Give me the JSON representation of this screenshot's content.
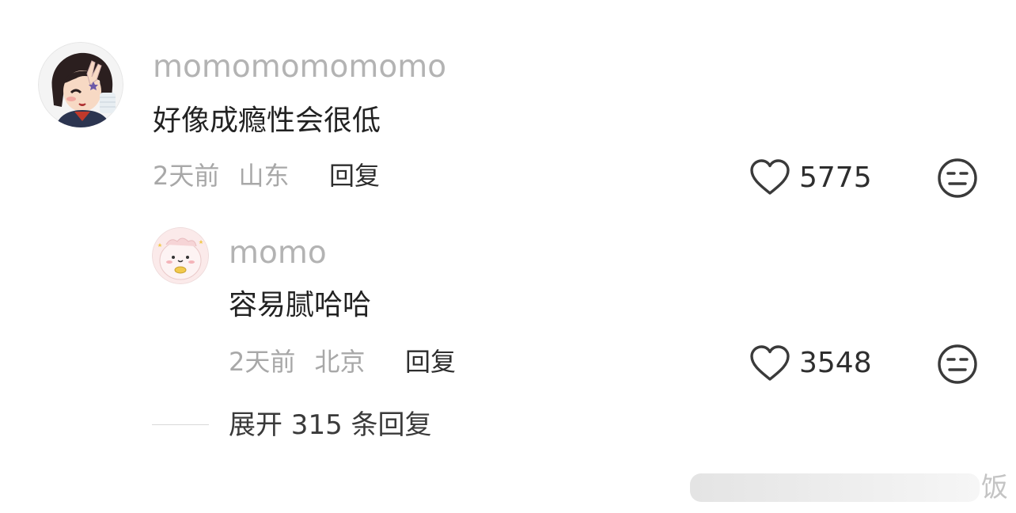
{
  "comments": [
    {
      "username": "momomomomomo",
      "text": "好像成瘾性会很低",
      "time": "2天前",
      "location": "山东",
      "reply_label": "回复",
      "likes": "5775",
      "avatar_icon": "avatar-girl-icon"
    },
    {
      "username": "momo",
      "text": "容易腻哈哈",
      "time": "2天前",
      "location": "北京",
      "reply_label": "回复",
      "likes": "3548",
      "avatar_icon": "avatar-pink-creature-icon"
    }
  ],
  "expand": {
    "label": "展开 315 条回复"
  },
  "watermark": {
    "text": "饭"
  },
  "icons": {
    "like": "heart-outline-icon",
    "dislike": "meh-face-icon"
  },
  "colors": {
    "username": "#b3b3b3",
    "text": "#222222",
    "meta": "#a8a8a8",
    "action": "#2e2e2e"
  }
}
